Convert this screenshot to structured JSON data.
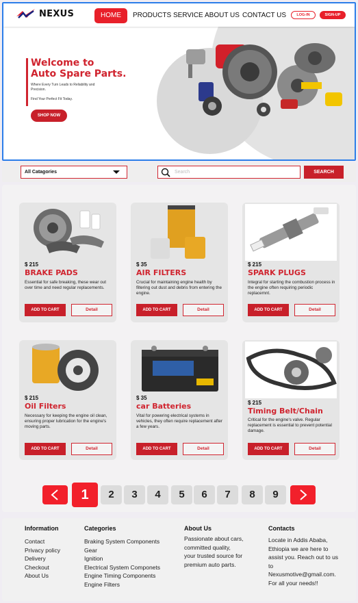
{
  "brand": {
    "name": "NEXUS"
  },
  "nav": {
    "home": "HOME",
    "products": "PRODUCTS",
    "service": "SERVICE",
    "about": "ABOUT US",
    "contact": "CONTACT US",
    "login": "LOG-IN",
    "signup": "SIGN-UP"
  },
  "hero": {
    "title_line1": "Welcome to",
    "title_line2": "Auto Spare Parts.",
    "subtitle": "Where Every Turn Leads to Reliability and Precision.",
    "tagline": "Find Your Perfect Fit Today.",
    "cta": "SHOP NOW"
  },
  "search": {
    "category_value": "All Catagories",
    "placeholder": "Search",
    "button": "SEARCH"
  },
  "products": [
    {
      "price": "$ 215",
      "name": "BRAKE PADS",
      "desc": "Essential for safe breaking, these wear out over time and need regular replacements.",
      "cart": "ADD TO CART",
      "detail": "Detail"
    },
    {
      "price": "$ 35",
      "name": "AIR FILTERS",
      "desc": "Crucial for maintaining engine health by filtering out dust and debris from entering the engine.",
      "cart": "ADD TO CART",
      "detail": "Detail"
    },
    {
      "price": "$ 215",
      "name": "SPARK PLUGS",
      "desc": "Integral for starting the combustion process in the engine often requiring periodic replacemnt.",
      "cart": "ADD TO CART",
      "detail": "Detail"
    },
    {
      "price": "$ 215",
      "name": "Oil Filters",
      "desc": "Necessary for keeping the engine oil clean, ensuring proper lubrication for the engine's moving parts.",
      "cart": "ADD TO CART",
      "detail": "Detail"
    },
    {
      "price": "$ 35",
      "name": "car Batteries",
      "desc": "Vital for powering electrical systems in vehicles, they often require replacement after a few years.",
      "cart": "ADD TO CART",
      "detail": "Detail"
    },
    {
      "price": "$ 215",
      "name": "Timing Belt/Chain",
      "desc": "Critical for the engine's valve. Regular replacement is essential to prevent potential damage.",
      "cart": "ADD TO CART",
      "detail": "Detail"
    }
  ],
  "pagination": {
    "pages": [
      "1",
      "2",
      "3",
      "4",
      "5",
      "6",
      "7",
      "8",
      "9"
    ],
    "current": "1"
  },
  "footer": {
    "information": {
      "title": "Information",
      "items": [
        "Contact",
        "Privacy policy",
        "Delivery",
        "Checkout",
        "About Us"
      ]
    },
    "categories": {
      "title": "Categories",
      "items": [
        "Braking System Components",
        "Gear",
        "Ignition",
        "Electrical System Componets",
        "Engine Timing Components",
        "Engine Filters"
      ]
    },
    "about": {
      "title": "About Us",
      "lines": [
        "Passionate about cars,",
        "committed quality,",
        "your trusted source for",
        "premium auto parts."
      ]
    },
    "contacts": {
      "title": "Contacts",
      "lines": [
        "Locate in Addis Ababa,",
        "Ethiopia we are here to",
        "assist you. Reach out to us",
        "to",
        "Nexusmotive@gmail.com.",
        "For all your needs!!"
      ]
    }
  },
  "colors": {
    "accent": "#e8202a",
    "dark_red": "#c8202a",
    "highlight": "#2b7de9"
  },
  "icons": {
    "search": "search-icon",
    "logo": "nexus-logo-icon",
    "prev": "chevron-left-icon",
    "next": "chevron-right-icon",
    "dropdown": "chevron-down-icon"
  }
}
